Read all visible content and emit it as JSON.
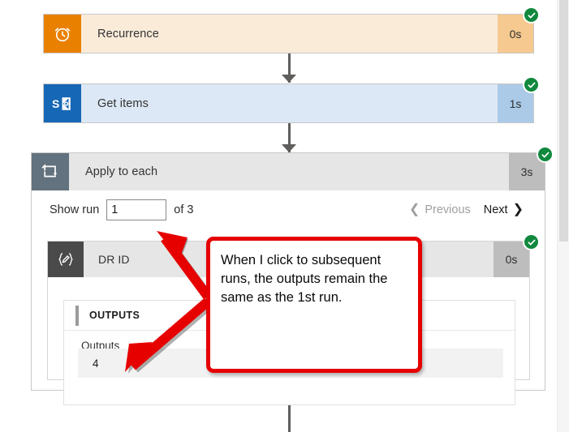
{
  "flow": {
    "steps": [
      {
        "id": "recurrence",
        "name": "Recurrence",
        "duration": "0s",
        "status": "succeeded",
        "icon": "alarm-clock-icon",
        "icon_bg": "#e98000",
        "body_bg": "#faebd9",
        "duration_bg": "#f5c98f"
      },
      {
        "id": "get-items",
        "name": "Get items",
        "duration": "1s",
        "status": "succeeded",
        "icon": "sharepoint-icon",
        "icon_bg": "#1667b5",
        "body_bg": "#dce8f5",
        "duration_bg": "#abcae8"
      }
    ],
    "scope": {
      "name": "Apply to each",
      "duration": "3s",
      "status": "succeeded",
      "icon": "loop-icon"
    },
    "inner_action": {
      "name": "DR ID",
      "duration": "0s",
      "status": "succeeded",
      "icon": "compose-braces-icon"
    }
  },
  "pager": {
    "show_run_label": "Show run",
    "run_value": "1",
    "run_placeholder": "",
    "of_label": "of 3",
    "previous_label": "Previous",
    "next_label": "Next",
    "previous_enabled": false,
    "next_enabled": true
  },
  "outputs": {
    "section_title": "OUTPUTS",
    "field_label": "Outputs",
    "field_value": "4"
  },
  "annotation": {
    "text": "When I click to subsequent runs, the outputs remain the same as the 1st run.",
    "color": "#e60000"
  },
  "colors": {
    "success_green": "#10893e",
    "scope_header": "#e6e6e6",
    "scope_icon": "#62727e",
    "compose_icon": "#4a4a4a",
    "duration_gray": "#bdbdbd",
    "connector": "#605e5c"
  }
}
